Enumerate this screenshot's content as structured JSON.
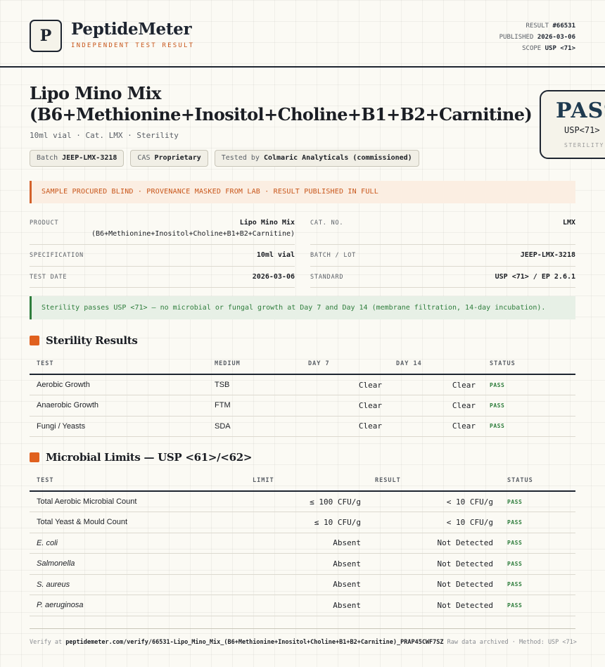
{
  "brand": {
    "logo_letter": "P",
    "name": "PeptideMeter",
    "tagline": "INDEPENDENT TEST RESULT"
  },
  "meta": {
    "result_label": "RESULT",
    "result_value": "#66531",
    "published_label": "PUBLISHED",
    "published_value": "2026-03-06",
    "scope_label": "SCOPE",
    "scope_value": "USP <71>"
  },
  "product": {
    "title_line1": "Lipo Mino Mix",
    "title_line2": "(B6+Methionine+Inositol+Choline+B1+B2+Carnitine)",
    "subtitle": "10ml vial · Cat. LMX · Sterility"
  },
  "chips": [
    {
      "label": "Batch",
      "value": "JEEP-LMX-3218"
    },
    {
      "label": "CAS",
      "value": "Proprietary"
    },
    {
      "label": "Tested by",
      "value": "Colmaric Analyticals (commissioned)"
    }
  ],
  "badge": {
    "verdict": "PASS",
    "standard": "USP<71>",
    "category": "STERILITY"
  },
  "notice": "SAMPLE PROCURED BLIND · PROVENANCE MASKED FROM LAB · RESULT PUBLISHED IN FULL",
  "specs": {
    "product_label": "PRODUCT",
    "product_line1": "Lipo Mino Mix",
    "product_line2": "(B6+Methionine+Inositol+Choline+B1+B2+Carnitine)",
    "catno_label": "CAT. NO.",
    "catno_value": "LMX",
    "spec_label": "SPECIFICATION",
    "spec_value": "10ml vial",
    "batch_label": "BATCH / LOT",
    "batch_value": "JEEP-LMX-3218",
    "date_label": "TEST DATE",
    "date_value": "2026-03-06",
    "standard_label": "STANDARD",
    "standard_value": "USP <71> / EP 2.6.1"
  },
  "summary": "Sterility passes USP <71> — no microbial or fungal growth at Day 7 and Day 14 (membrane filtration, 14-day incubation).",
  "sterility": {
    "title": "Sterility Results",
    "headers": [
      "TEST",
      "MEDIUM",
      "DAY 7",
      "DAY 14",
      "STATUS"
    ],
    "rows": [
      {
        "test": "Aerobic Growth",
        "medium": "TSB",
        "day7": "Clear",
        "day14": "Clear",
        "status": "PASS"
      },
      {
        "test": "Anaerobic Growth",
        "medium": "FTM",
        "day7": "Clear",
        "day14": "Clear",
        "status": "PASS"
      },
      {
        "test": "Fungi / Yeasts",
        "medium": "SDA",
        "day7": "Clear",
        "day14": "Clear",
        "status": "PASS"
      }
    ]
  },
  "microbial": {
    "title": "Microbial Limits — USP <61>/<62>",
    "headers": [
      "TEST",
      "LIMIT",
      "RESULT",
      "STATUS"
    ],
    "rows": [
      {
        "test": "Total Aerobic Microbial Count",
        "limit": "≤ 100 CFU/g",
        "result": "< 10 CFU/g",
        "status": "PASS"
      },
      {
        "test": "Total Yeast & Mould Count",
        "limit": "≤ 10 CFU/g",
        "result": "< 10 CFU/g",
        "status": "PASS"
      },
      {
        "test": "E. coli",
        "limit": "Absent",
        "result": "Not Detected",
        "status": "PASS"
      },
      {
        "test": "Salmonella",
        "limit": "Absent",
        "result": "Not Detected",
        "status": "PASS"
      },
      {
        "test": "S. aureus",
        "limit": "Absent",
        "result": "Not Detected",
        "status": "PASS"
      },
      {
        "test": "P. aeruginosa",
        "limit": "Absent",
        "result": "Not Detected",
        "status": "PASS"
      }
    ]
  },
  "footer": {
    "verify_prefix": "Verify at",
    "verify_url": "peptidemeter.com/verify/66531-Lipo_Mino_Mix_(B6+Methionine+Inositol+Choline+B1+B2+Carnitine)_PRAP45CWF7SZ",
    "archive_note": "Raw data archived · Method: USP <71>"
  }
}
